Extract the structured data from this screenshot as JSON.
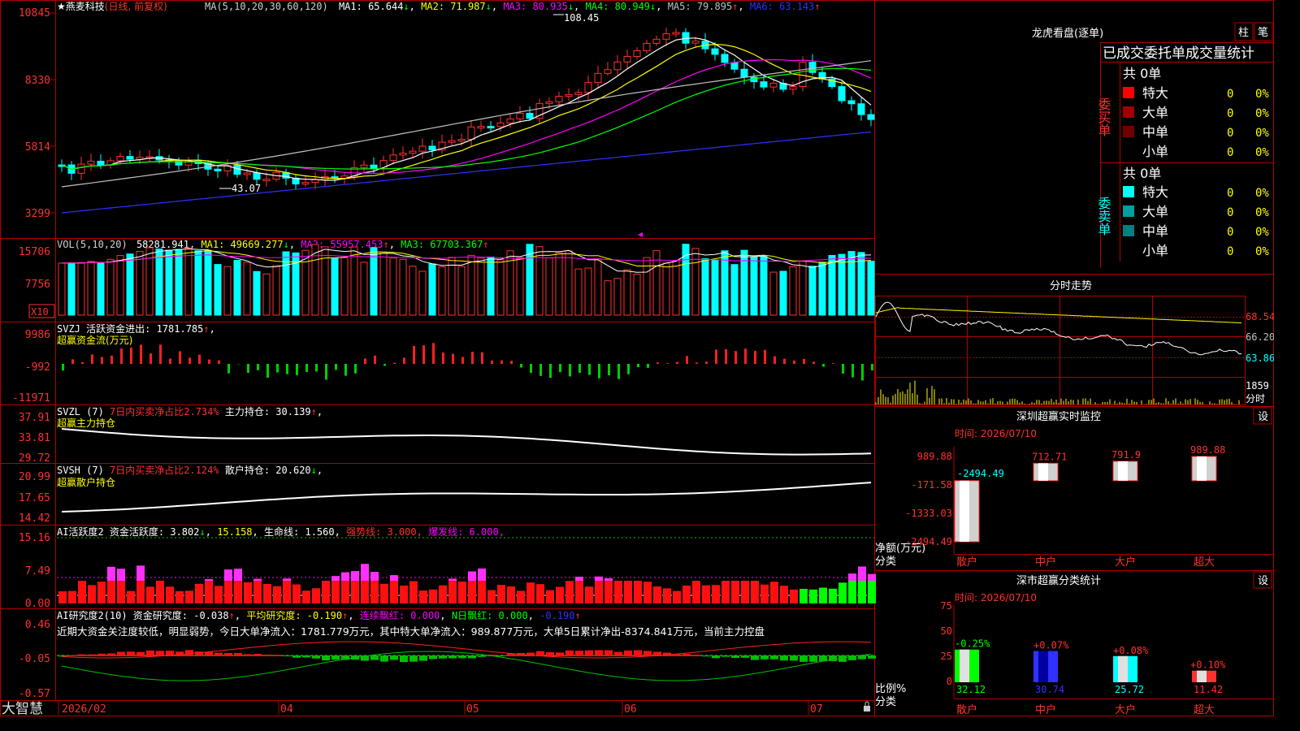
{
  "stock": {
    "name": "燕麦科技",
    "mode": "(日线, 前复权)"
  },
  "price_axis": [
    "10845",
    "8330",
    "5814",
    "3299"
  ],
  "ma_legend": {
    "label": "MA(5,10,20,30,60,120)",
    "ma1": "MA1: 65.644",
    "ma2": "MA2: 71.987",
    "ma3": "MA3: 80.935",
    "ma4": "MA4: 80.949",
    "ma5": "MA5: 79.895",
    "ma6": "MA6: 63.143"
  },
  "price_marks": {
    "high": "108.45",
    "low": "43.07"
  },
  "vol_panel": {
    "label": "VOL(5,10,20)",
    "v": "58281.941",
    "ma1": "MA1: 49669.277",
    "ma2": "MA2: 55957.453",
    "ma3": "MA3: 67703.367",
    "axis": [
      "15706",
      "7756"
    ],
    "unit": "X10"
  },
  "svzj": {
    "label": "SVZJ  活跃资金进出: 1781.785",
    "sub": "超赢资金流(万元)",
    "axis": [
      "9986",
      "-992",
      "-11971"
    ]
  },
  "svzl": {
    "label": "SVZL (7)",
    "a": "7日内买卖净占比2.734%",
    "b": "主力持仓: 30.139",
    "sub": "超赢主力持仓",
    "axis": [
      "37.91",
      "33.81",
      "29.72"
    ]
  },
  "svsh": {
    "label": "SVSH (7)",
    "a": "7日内买卖净占比2.124%",
    "b": "散户持仓: 20.620",
    "sub": "超赢散户持仓",
    "axis": [
      "20.99",
      "17.65",
      "14.42"
    ]
  },
  "ai_active": {
    "a": "AI活跃度2 资金活跃度: 3.802",
    "b": "15.158",
    "c": "生命线: 1.560",
    "d": "强势线: 3.000",
    "e": "爆发线: 6.000",
    "axis": [
      "15.16",
      "7.49",
      "0.00"
    ]
  },
  "ai_research": {
    "a": "AI研究度2(10) 资金研究度: -0.038",
    "b": "平均研究度: -0.190",
    "c": "连续飘红: 0.000",
    "d": "N日飘红: 0.000",
    "e": "-0.190",
    "note": "近期大资金关注度较低，明显弱势，今日大单净流入：1781.779万元，其中特大单净流入：989.877万元，大单5日累计净出-8374.841万元，当前主力控盘",
    "axis": [
      "0.46",
      "-0.05",
      "-0.57"
    ]
  },
  "date_axis": [
    "2026/02",
    "04",
    "05",
    "06",
    "07"
  ],
  "brand": "大智慧",
  "right": {
    "title": "龙虎看盘(逐单)",
    "btn1": "柱",
    "btn2": "笔",
    "tabs": "已成交委托单成交量统计",
    "buy_label": "委买单",
    "sell_label": "委卖单",
    "buy_total": "共 0单",
    "sell_total": "共 0单",
    "buy_rows": [
      {
        "name": "特大",
        "v": "0",
        "p": "0%"
      },
      {
        "name": "大单",
        "v": "0",
        "p": "0%"
      },
      {
        "name": "中单",
        "v": "0",
        "p": "0%"
      },
      {
        "name": "小单",
        "v": "0",
        "p": "0%"
      }
    ],
    "sell_rows": [
      {
        "name": "特大",
        "v": "0",
        "p": "0%"
      },
      {
        "name": "大单",
        "v": "0",
        "p": "0%"
      },
      {
        "name": "中单",
        "v": "0",
        "p": "0%"
      },
      {
        "name": "小单",
        "v": "0",
        "p": "0%"
      }
    ],
    "intraday_title": "分时走势",
    "intraday_axis": [
      "68.54",
      "66.20",
      "63.86"
    ],
    "intraday_vol": "1859",
    "intraday_unit": "分时",
    "monitor_title": "深圳超赢实时监控",
    "monitor_time": "时间: 2026/07/10",
    "monitor_axis": [
      "989.88",
      "-171.58",
      "-1333.03",
      "-2494.49"
    ],
    "monitor_ylabel": "净额(万元)",
    "monitor_xlabel": "分类",
    "categories": [
      "散户",
      "中户",
      "大户",
      "超大"
    ],
    "stats_title": "深市超赢分类统计",
    "stats_time": "时间: 2026/07/10",
    "stats_axis": [
      "75",
      "50",
      "25",
      "0"
    ],
    "stats_ylabel": "比例%",
    "stats_xlabel": "分类",
    "settings": "设"
  },
  "chart_data": [
    {
      "type": "bar",
      "title": "深圳超赢实时监控",
      "categories": [
        "散户",
        "中户",
        "大户",
        "超大"
      ],
      "values": [
        -2494.49,
        712.71,
        791.9,
        989.88
      ],
      "value_labels": [
        "-2494.49",
        "712.71",
        "791.9",
        "989.88"
      ],
      "ylabel": "净额(万元)",
      "xlabel": "分类",
      "ylim": [
        -2494.49,
        989.88
      ]
    },
    {
      "type": "bar",
      "title": "深市超赢分类统计",
      "categories": [
        "散户",
        "中户",
        "大户",
        "超大"
      ],
      "values": [
        32.12,
        30.74,
        25.72,
        11.42
      ],
      "value_labels": [
        "32.12",
        "30.74",
        "25.72",
        "11.42"
      ],
      "changes": [
        "-0.25%",
        "+0.07%",
        "+0.08%",
        "+0.10%"
      ],
      "ylabel": "比例%",
      "xlabel": "分类",
      "ylim": [
        0,
        75
      ]
    }
  ]
}
